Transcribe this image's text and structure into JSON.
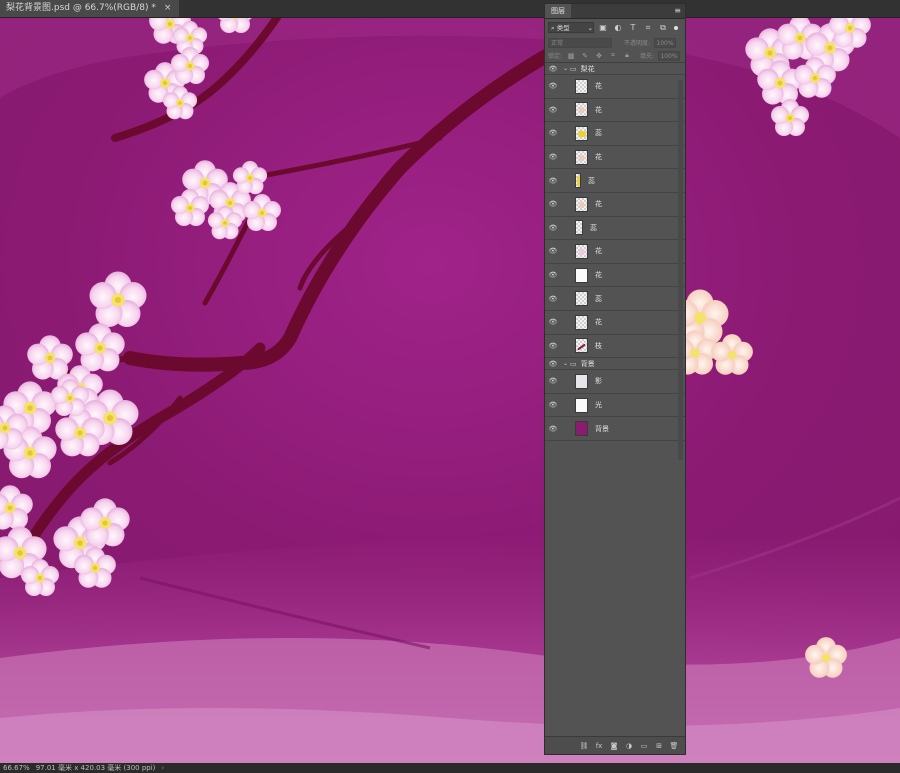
{
  "document": {
    "tab_title": "梨花背景图.psd @ 66.7%(RGB/8) *",
    "close_icon": "×"
  },
  "status": {
    "zoom": "66.67%",
    "doc_size": "97.01 毫米 x 420.03 毫米 (300 ppi)",
    "arrow": "›"
  },
  "panel": {
    "tab": "图层",
    "menu_icon": "≡",
    "filter_kind": "类型",
    "blend_mode": "正常",
    "opacity_label": "不透明度:",
    "opacity_value": "100%",
    "lock_label": "锁定:",
    "fill_label": "填充:",
    "fill_value": "100%"
  },
  "layers": [
    {
      "type": "group",
      "name": "梨花",
      "visible": true
    },
    {
      "type": "layer",
      "name": "花",
      "visible": true,
      "thumb": "transparent"
    },
    {
      "type": "layer",
      "name": "花",
      "visible": true,
      "thumb": "petal"
    },
    {
      "type": "layer",
      "name": "蕊",
      "visible": true,
      "thumb": "yellow"
    },
    {
      "type": "layer",
      "name": "花",
      "visible": true,
      "thumb": "petal"
    },
    {
      "type": "layer",
      "name": "蕊",
      "visible": true,
      "thumb": "yellow-thin"
    },
    {
      "type": "layer",
      "name": "花",
      "visible": true,
      "thumb": "petal"
    },
    {
      "type": "layer",
      "name": "蕊",
      "visible": true,
      "thumb": "transparent"
    },
    {
      "type": "layer",
      "name": "花",
      "visible": true,
      "thumb": "pink"
    },
    {
      "type": "layer",
      "name": "花",
      "visible": true,
      "thumb": "white"
    },
    {
      "type": "layer",
      "name": "蕊",
      "visible": true,
      "thumb": "transparent"
    },
    {
      "type": "layer",
      "name": "花",
      "visible": true,
      "thumb": "transparent"
    },
    {
      "type": "layer",
      "name": "枝",
      "visible": true,
      "thumb": "branch"
    },
    {
      "type": "group",
      "name": "背景",
      "visible": true
    },
    {
      "type": "layer",
      "name": "影",
      "visible": true,
      "thumb": "light"
    },
    {
      "type": "layer",
      "name": "光",
      "visible": true,
      "thumb": "white"
    },
    {
      "type": "layer",
      "name": "背景",
      "visible": true,
      "thumb": "purple"
    }
  ],
  "colors": {
    "canvas_bg": "#8b1b6e",
    "branch": "#6b0a2e",
    "petal": "#f3c8ec",
    "stamen": "#f4e04a"
  }
}
